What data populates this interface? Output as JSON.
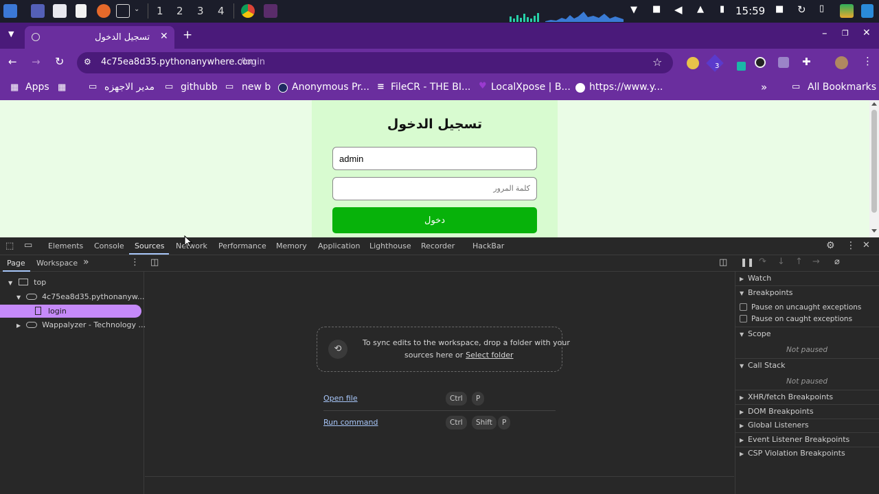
{
  "taskbar": {
    "workspaces": [
      "1",
      "2",
      "3",
      "4"
    ],
    "clock": "15:59"
  },
  "browser": {
    "tab_title": "تسجيل الدخول",
    "url_domain": "4c75ea8d35.pythonanywhere.com",
    "url_path": "/login",
    "extension_badge": "3",
    "bookmarks": [
      "Apps",
      "مدير الاجهزه",
      "githubb",
      "new b",
      "Anonymous Pr...",
      "FileCR - THE BI...",
      "LocalXpose | B...",
      "https://www.y..."
    ],
    "all_bookmarks": "All Bookmarks"
  },
  "page": {
    "heading": "تسجيل الدخول",
    "username_value": "admin",
    "password_placeholder": "كلمة المرور",
    "login_button": "دخول"
  },
  "devtools": {
    "tabs": [
      "Elements",
      "Console",
      "Sources",
      "Network",
      "Performance",
      "Memory",
      "Application",
      "Lighthouse",
      "Recorder",
      "HackBar"
    ],
    "active_tab": "Sources",
    "subtabs": [
      "Page",
      "Workspace"
    ],
    "tree": {
      "top": "top",
      "domain": "4c75ea8d35.pythonanyw...",
      "file": "login",
      "wappalyzer": "Wappalyzer - Technology ..."
    },
    "dropzone": {
      "text_line1": "To sync edits to the workspace, drop a folder with your",
      "text_line2": "sources here or",
      "link": "Select folder"
    },
    "shortcuts": [
      {
        "label": "Open file",
        "keys": [
          "Ctrl",
          "P"
        ]
      },
      {
        "label": "Run command",
        "keys": [
          "Ctrl",
          "Shift",
          "P"
        ]
      }
    ],
    "debugger": {
      "watch": "Watch",
      "breakpoints": "Breakpoints",
      "pause_uncaught": "Pause on uncaught exceptions",
      "pause_caught": "Pause on caught exceptions",
      "scope": "Scope",
      "not_paused": "Not paused",
      "call_stack": "Call Stack",
      "xhr": "XHR/fetch Breakpoints",
      "dom": "DOM Breakpoints",
      "global": "Global Listeners",
      "event": "Event Listener Breakpoints",
      "csp": "CSP Violation Breakpoints"
    }
  },
  "colors": {
    "chrome_dark": "#4a1a7a",
    "chrome_light": "#6a2e9e",
    "page_bg": "#eafce6",
    "login_button": "#07b20a",
    "devtools_bg": "#282828",
    "selected_file": "#c58af9"
  }
}
